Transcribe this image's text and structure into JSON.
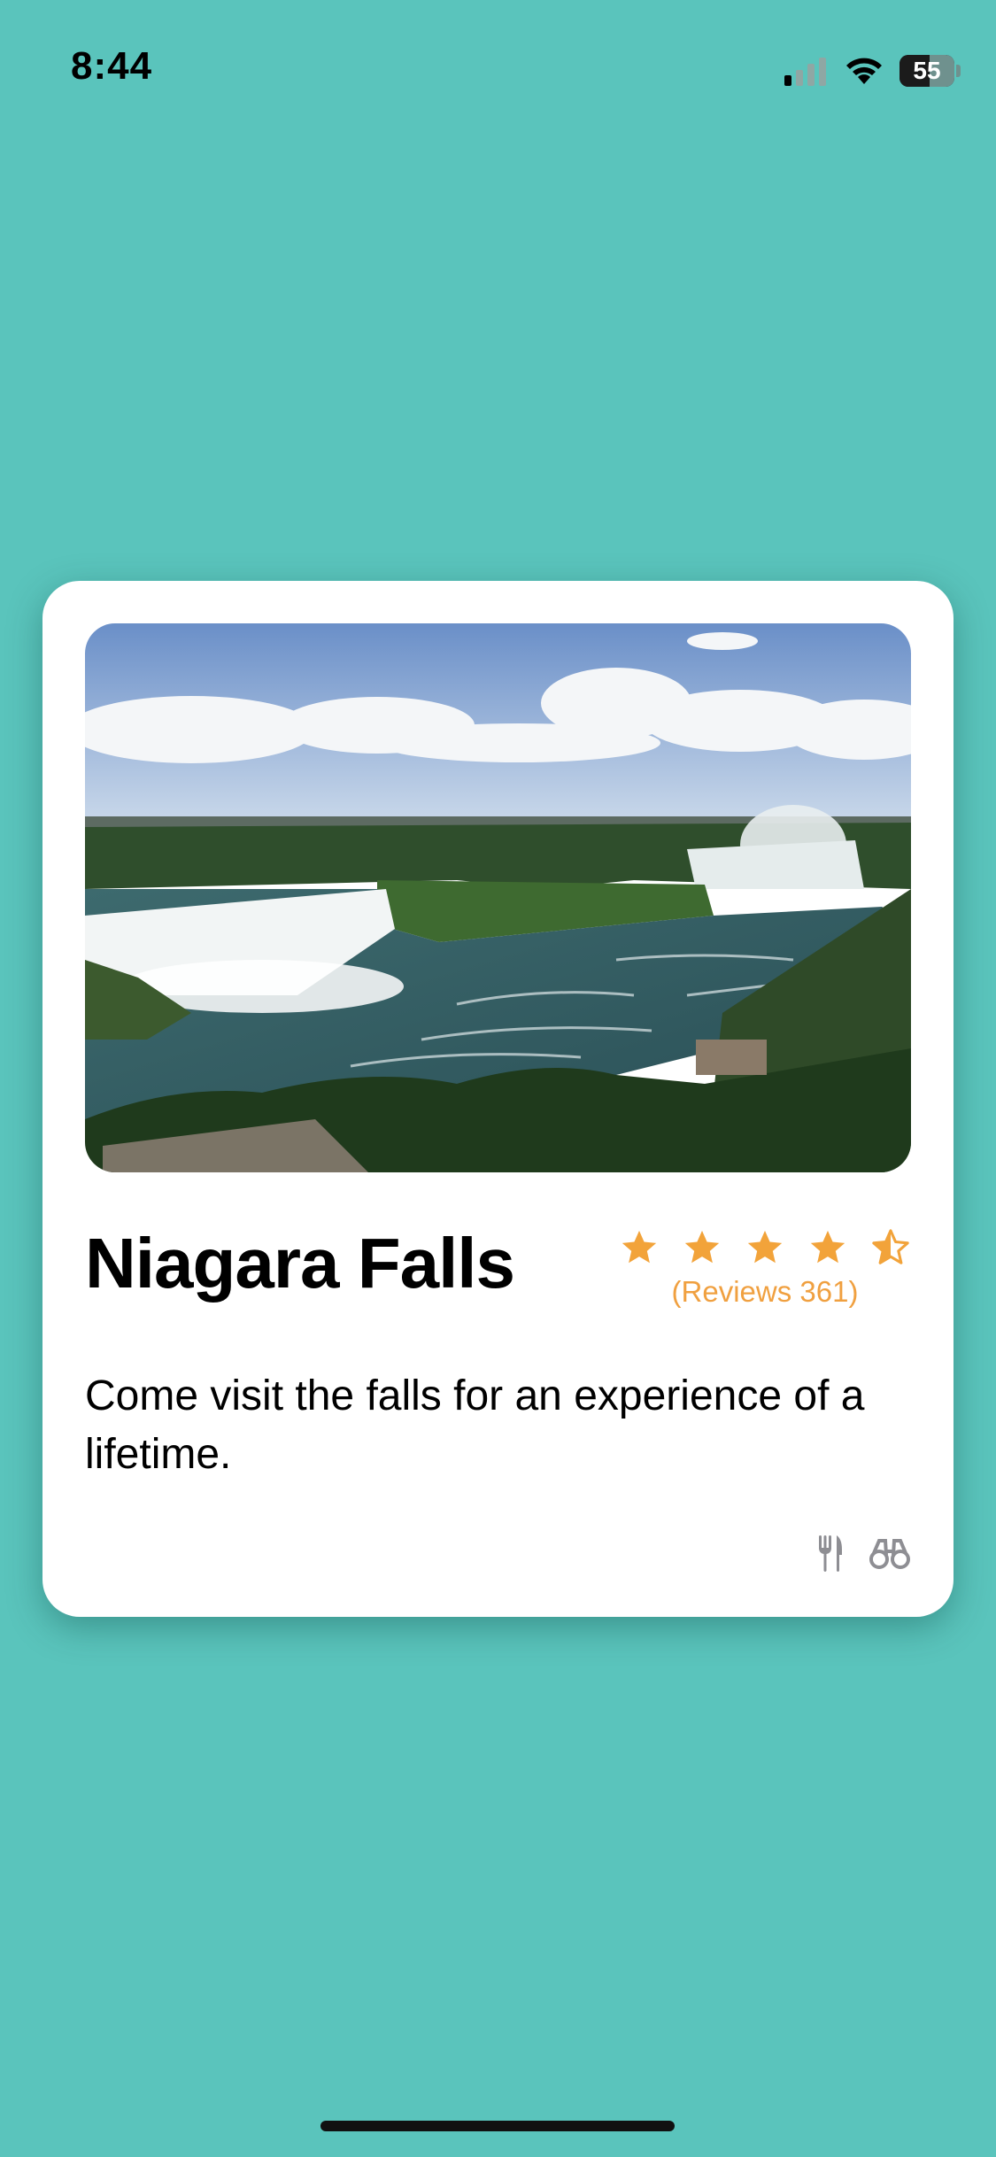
{
  "status_bar": {
    "time": "8:44",
    "battery_level": "55",
    "signal_bars_active": 1,
    "signal_bars_total": 4
  },
  "card": {
    "image_description_icon": "waterfall-photo",
    "title": "Niagara Falls",
    "rating": {
      "value": 4.5,
      "max": 5,
      "reviews_text": "(Reviews 361)",
      "star_color": "#f2a33a"
    },
    "description": "Come visit the falls for an experience of a lifetime.",
    "amenity_icons": [
      "fork-knife-icon",
      "binoculars-icon"
    ]
  },
  "colors": {
    "background": "#5ac4bc",
    "card": "#ffffff",
    "accent": "#f2a33a"
  }
}
